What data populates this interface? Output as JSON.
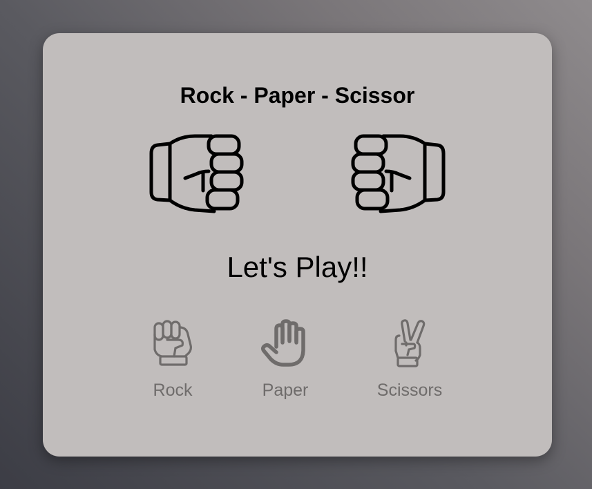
{
  "game": {
    "title": "Rock - Paper - Scissor",
    "status": "Let's Play!!",
    "player_hand_icon": "fist-icon",
    "computer_hand_icon": "fist-icon"
  },
  "choices": [
    {
      "label": "Rock",
      "icon": "rock-hand-icon"
    },
    {
      "label": "Paper",
      "icon": "paper-hand-icon"
    },
    {
      "label": "Scissors",
      "icon": "scissors-hand-icon"
    }
  ],
  "colors": {
    "card_background": "#c1bdbc",
    "choice_color": "#6f6c6b",
    "text": "#000000"
  }
}
